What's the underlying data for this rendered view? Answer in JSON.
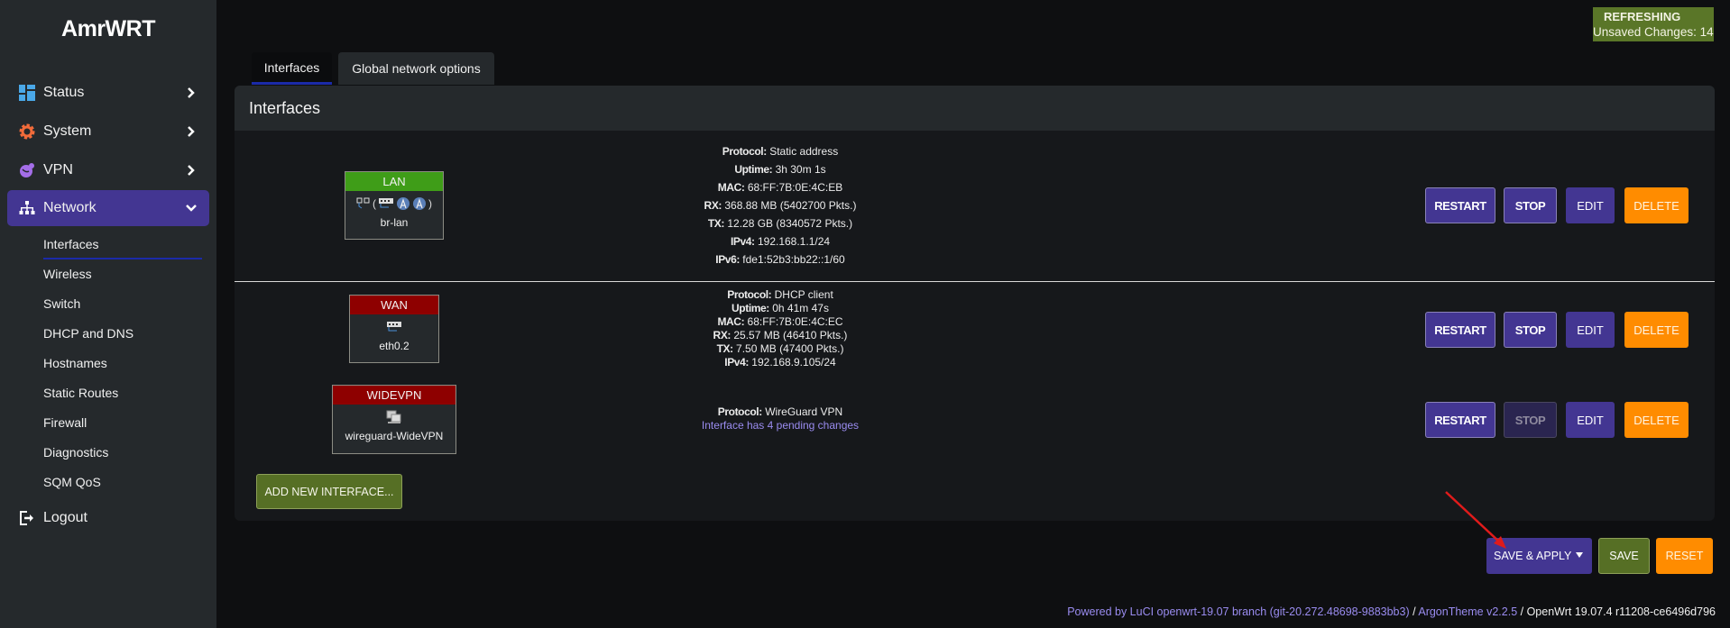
{
  "brand": "AmrWRT",
  "sidebar": {
    "items": [
      {
        "label": "Status",
        "icon": "dashboard-icon"
      },
      {
        "label": "System",
        "icon": "gear-icon"
      },
      {
        "label": "VPN",
        "icon": "globe-icon"
      },
      {
        "label": "Network",
        "icon": "sitemap-icon",
        "active": true
      }
    ],
    "submenu": [
      "Interfaces",
      "Wireless",
      "Switch",
      "DHCP and DNS",
      "Hostnames",
      "Static Routes",
      "Firewall",
      "Diagnostics",
      "SQM QoS"
    ],
    "active_submenu": "Interfaces",
    "logout": "Logout"
  },
  "indicator": {
    "title": "REFRESHING",
    "subtitle": "Unsaved Changes: 14",
    "color": "#5a7628"
  },
  "tabs": [
    {
      "label": "Interfaces",
      "active": true
    },
    {
      "label": "Global network options",
      "active": false
    }
  ],
  "panel": {
    "title": "Interfaces"
  },
  "interfaces": [
    {
      "name": "LAN",
      "zone_color": "#3f9d18",
      "device": "br-lan",
      "icons": [
        "bridge-icon",
        "ethernet-switch-icon",
        "wifi-icon",
        "wifi-icon"
      ],
      "info": [
        {
          "k": "Protocol:",
          "v": "Static address"
        },
        {
          "k": "Uptime:",
          "v": "3h 30m 1s"
        },
        {
          "k": "MAC:",
          "v": "68:FF:7B:0E:4C:EB"
        },
        {
          "k": "RX:",
          "v": "368.88 MB (5402700 Pkts.)"
        },
        {
          "k": "TX:",
          "v": "12.28 GB (8340572 Pkts.)"
        },
        {
          "k": "IPv4:",
          "v": "192.168.1.1/24"
        },
        {
          "k": "IPv6:",
          "v": "fde1:52b3:bb22::1/60"
        }
      ],
      "stop_disabled": false
    },
    {
      "name": "WAN",
      "zone_color": "#8e0000",
      "device": "eth0.2",
      "icons": [
        "ethernet-port-icon"
      ],
      "info": [
        {
          "k": "Protocol:",
          "v": "DHCP client"
        },
        {
          "k": "Uptime:",
          "v": "0h 41m 47s"
        },
        {
          "k": "MAC:",
          "v": "68:FF:7B:0E:4C:EC"
        },
        {
          "k": "RX:",
          "v": "25.57 MB (46410 Pkts.)"
        },
        {
          "k": "TX:",
          "v": "7.50 MB (47400 Pkts.)"
        },
        {
          "k": "IPv4:",
          "v": "192.168.9.105/24"
        }
      ],
      "stop_disabled": false
    },
    {
      "name": "WIDEVPN",
      "zone_color": "#8e0000",
      "device": "wireguard-WideVPN",
      "icons": [
        "tunnel-icon"
      ],
      "info": [
        {
          "k": "Protocol:",
          "v": "WireGuard VPN"
        }
      ],
      "pending": "Interface has 4 pending changes",
      "stop_disabled": true
    }
  ],
  "buttons": {
    "restart": "RESTART",
    "stop": "STOP",
    "edit": "EDIT",
    "delete": "DELETE",
    "add_interface": "ADD NEW INTERFACE...",
    "save_apply": "SAVE & APPLY",
    "save": "SAVE",
    "reset": "RESET"
  },
  "footer": {
    "luci": "Powered by LuCI openwrt-19.07 branch (git-20.272.48698-9883bb3)",
    "sep1": " / ",
    "theme": "ArgonTheme v2.2.5",
    "sep2": " / ",
    "os": "OpenWrt 19.07.4 r11208-ce6496d796"
  }
}
